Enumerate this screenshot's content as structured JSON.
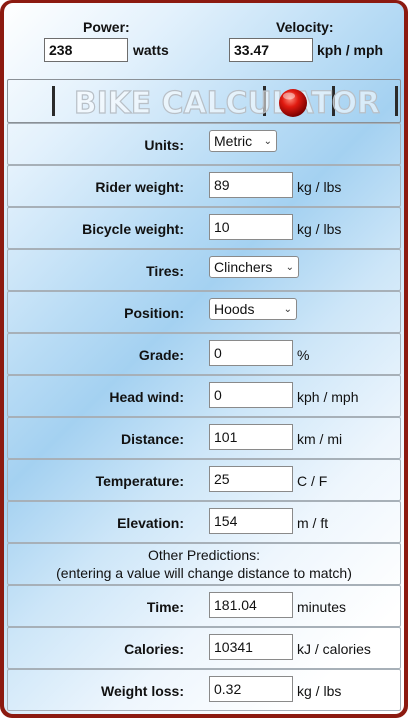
{
  "header": {
    "power_label": "Power:",
    "power_value": "238",
    "power_unit": "watts",
    "velocity_label": "Velocity:",
    "velocity_value": "33.47",
    "velocity_unit": "kph / mph"
  },
  "banner": {
    "text": "BIKE CALCULATOR"
  },
  "fields": {
    "units": {
      "label": "Units:",
      "value": "Metric"
    },
    "rider_weight": {
      "label": "Rider weight:",
      "value": "89",
      "unit": "kg / lbs"
    },
    "bicycle_weight": {
      "label": "Bicycle weight:",
      "value": "10",
      "unit": "kg / lbs"
    },
    "tires": {
      "label": "Tires:",
      "value": "Clinchers"
    },
    "position": {
      "label": "Position:",
      "value": "Hoods"
    },
    "grade": {
      "label": "Grade:",
      "value": "0",
      "unit": "%"
    },
    "head_wind": {
      "label": "Head wind:",
      "value": "0",
      "unit": "kph / mph"
    },
    "distance": {
      "label": "Distance:",
      "value": "101",
      "unit": "km / mi"
    },
    "temperature": {
      "label": "Temperature:",
      "value": "25",
      "unit": "C / F"
    },
    "elevation": {
      "label": "Elevation:",
      "value": "154",
      "unit": "m / ft"
    }
  },
  "predictions": {
    "heading_line1": "Other Predictions:",
    "heading_line2": "(entering a value will change distance to match)",
    "time": {
      "label": "Time:",
      "value": "181.04",
      "unit": "minutes"
    },
    "calories": {
      "label": "Calories:",
      "value": "10341",
      "unit": "kJ / calories"
    },
    "weight_loss": {
      "label": "Weight loss:",
      "value": "0.32",
      "unit": "kg / lbs"
    }
  }
}
